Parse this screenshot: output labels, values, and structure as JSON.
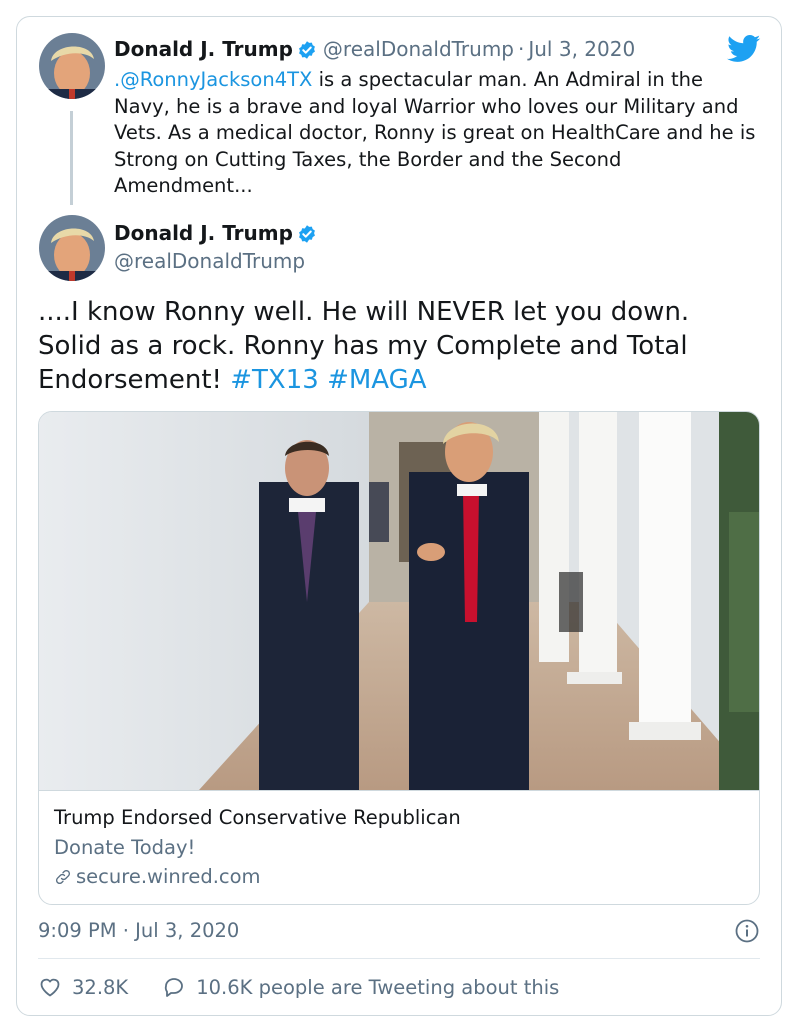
{
  "tweet1": {
    "name": "Donald J. Trump",
    "handle": "@realDonaldTrump",
    "separator": "·",
    "date": "Jul 3, 2020",
    "mention": ".@RonnyJackson4TX",
    "text": " is a spectacular man. An Admiral in the Navy, he is a brave and loyal Warrior who loves our Military and Vets. As a medical doctor, Ronny is great on HealthCare and he is Strong on Cutting Taxes, the Border and the Second Amendment..."
  },
  "tweet2": {
    "name": "Donald J. Trump",
    "handle": "@realDonaldTrump",
    "text": "....I know Ronny well. He will NEVER let you down. Solid as a rock. Ronny has my Complete and Total Endorsement! ",
    "hashtag1": "#TX13",
    "hashtag2": "#MAGA",
    "card": {
      "title": "Trump Endorsed Conservative Republican",
      "description": "Donate Today!",
      "domain": "secure.winred.com"
    },
    "timestamp": "9:09 PM · Jul 3, 2020",
    "likes": "32.8K",
    "replies_text": "10.6K people are Tweeting about this"
  },
  "icons": {
    "verified": "verified-badge-icon",
    "bird": "twitter-bird-icon",
    "link": "link-icon",
    "info": "info-icon",
    "heart": "heart-icon",
    "reply": "reply-bubble-icon"
  },
  "colors": {
    "link": "#1b95e0",
    "secondary": "#5b7083",
    "border": "#cfd9de",
    "twitter_blue": "#1da1f2"
  }
}
